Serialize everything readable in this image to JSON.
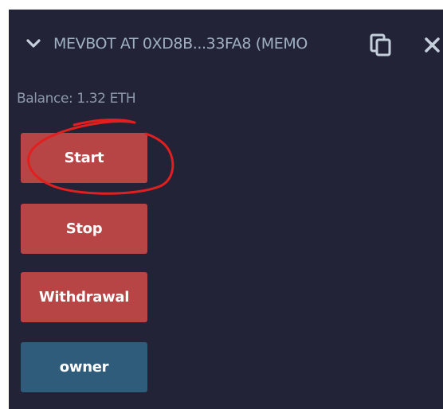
{
  "contract": {
    "title": "MEVBOT AT 0XD8B...33FA8 (MEMO",
    "balance": "Balance: 1.32 ETH"
  },
  "buttons": {
    "start": "Start",
    "stop": "Stop",
    "withdrawal": "Withdrawal",
    "owner": "owner"
  },
  "icons": {
    "chevron": "chevron-down-icon",
    "copy": "copy-icon",
    "close": "close-icon"
  },
  "colors": {
    "panel_bg": "#222336",
    "action_button": "#b84545",
    "view_button": "#2f5c7b",
    "annotation_circle": "#e21f1f"
  }
}
